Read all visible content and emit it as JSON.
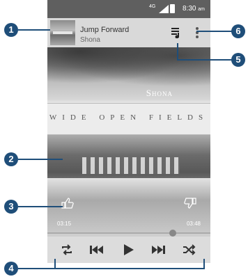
{
  "status_bar": {
    "network": "4G",
    "time": "8:30",
    "ampm": "am"
  },
  "now_playing": {
    "title": "Jump Forward",
    "artist": "Shona"
  },
  "album_art": {
    "artist_caption": "Shona",
    "album_caption": "WIDE OPEN FIELDS"
  },
  "playback": {
    "elapsed": "03:15",
    "total": "03:48"
  },
  "callouts": [
    "1",
    "2",
    "3",
    "4",
    "5",
    "6"
  ],
  "icons": {
    "queue": "queue-list-icon",
    "more": "more-vertical-icon",
    "thumbs_up": "thumbs-up-icon",
    "thumbs_down": "thumbs-down-icon",
    "repeat": "repeat-icon",
    "previous": "previous-track-icon",
    "play": "play-icon",
    "next": "next-track-icon",
    "shuffle": "shuffle-icon"
  },
  "colors": {
    "callout": "#1f4e79"
  }
}
